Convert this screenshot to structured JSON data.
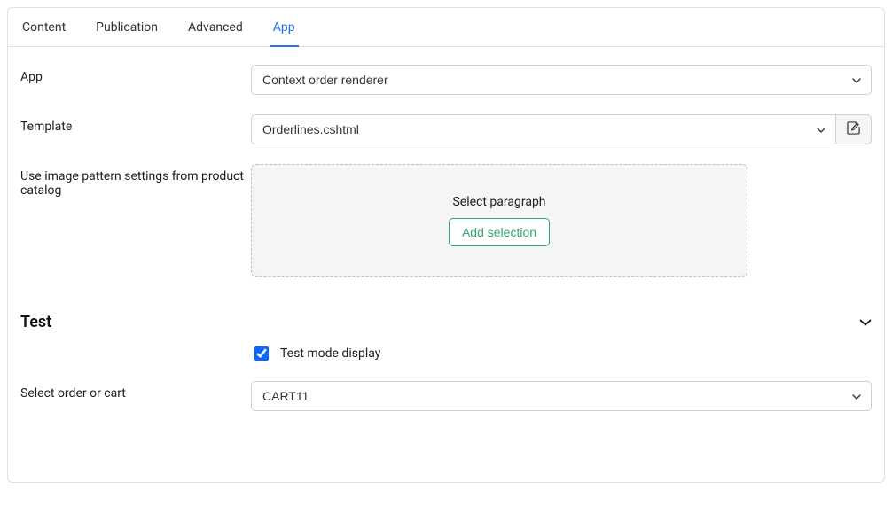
{
  "tabs": {
    "content": "Content",
    "publication": "Publication",
    "advanced": "Advanced",
    "app": "App"
  },
  "fields": {
    "app": {
      "label": "App",
      "value": "Context order renderer"
    },
    "template": {
      "label": "Template",
      "value": "Orderlines.cshtml"
    },
    "imagePattern": {
      "label": "Use image pattern settings from product catalog",
      "dropzone_text": "Select paragraph",
      "add_button": "Add selection"
    }
  },
  "sections": {
    "test": {
      "title": "Test",
      "testmode": {
        "label": "Test mode display",
        "checked": true
      },
      "order": {
        "label": "Select order or cart",
        "value": "CART11"
      }
    }
  }
}
